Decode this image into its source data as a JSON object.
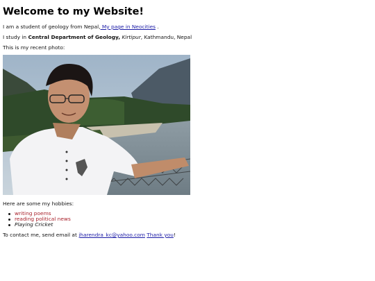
{
  "heading": "Welcome to my Website!",
  "intro": {
    "text": "I am a student of geology from Nepal,",
    "link": " My page in Neocities",
    "after": " ."
  },
  "study": {
    "prefix": "I study in ",
    "bold": "Central Department of Geology,",
    "italic": " Kirtipur",
    "suffix": ", Kathmandu, Nepal"
  },
  "photo_caption": "This is my recent photo:",
  "hobbies": {
    "intro": "Here are some my hobbies:",
    "items": [
      {
        "label": "writing poems",
        "style": "red"
      },
      {
        "label": "reading political news",
        "style": "red"
      },
      {
        "label": "Playing Cricket",
        "style": "italic"
      }
    ]
  },
  "contact": {
    "prefix": "To contact me, send email at ",
    "email": "jharendra_kc@yahoo.com",
    "thanks": "Thank you",
    "suffix": "!"
  },
  "colors": {
    "link": "#1a1aa6",
    "hobby_red": "#a8202a"
  }
}
